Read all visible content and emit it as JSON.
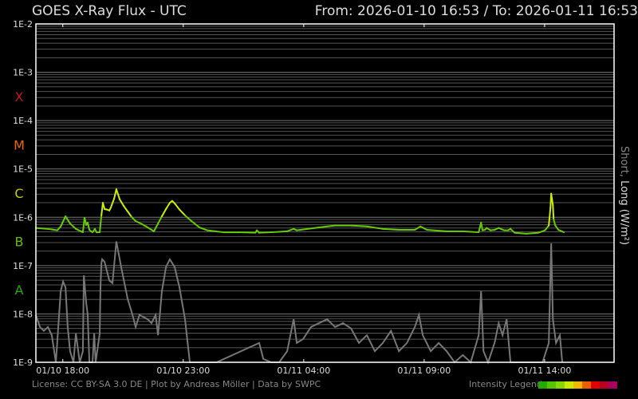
{
  "header": {
    "title": "GOES X-Ray Flux - UTC",
    "range": "From: 2026-01-10 16:53  /  To: 2026-01-11 16:53"
  },
  "footer": {
    "license": "License: CC BY-SA 3.0 DE | Plot by Andreas Möller | Data by SWPC",
    "legend_label": "Intensity Legend",
    "legend_colors": [
      "#22aa00",
      "#55c400",
      "#88d800",
      "#ccea00",
      "#f0b800",
      "#ea6000",
      "#e00000",
      "#b80020",
      "#a80060"
    ]
  },
  "chart_data": {
    "type": "line",
    "title": "GOES X-Ray Flux - UTC",
    "xlabel": "",
    "ylabel_short": "Short,",
    "ylabel_long": "Long (W/m²)",
    "y_scale": "log",
    "ylim_log10": [
      -9,
      -2
    ],
    "x_unit": "hours since 2026-01-10 16:53",
    "xlim": [
      0,
      24
    ],
    "y_ticks": [
      {
        "v": -2,
        "label": "1E-2"
      },
      {
        "v": -3,
        "label": "1E-3"
      },
      {
        "v": -4,
        "label": "1E-4"
      },
      {
        "v": -5,
        "label": "1E-5"
      },
      {
        "v": -6,
        "label": "1E-6"
      },
      {
        "v": -7,
        "label": "1E-7"
      },
      {
        "v": -8,
        "label": "1E-8"
      },
      {
        "v": -9,
        "label": "1E-9"
      }
    ],
    "classes": [
      {
        "label": "X",
        "v": -3.5,
        "color": "#cc1122"
      },
      {
        "label": "M",
        "v": -4.5,
        "color": "#ee6600"
      },
      {
        "label": "C",
        "v": -5.5,
        "color": "#cccc00"
      },
      {
        "label": "B",
        "v": -6.5,
        "color": "#66bb00"
      },
      {
        "label": "A",
        "v": -7.5,
        "color": "#22aa00"
      }
    ],
    "x_ticks": [
      {
        "v": 1.117,
        "label": "01/10 18:00"
      },
      {
        "v": 6.117,
        "label": "01/10 23:00"
      },
      {
        "v": 11.117,
        "label": "01/11 04:00"
      },
      {
        "v": 16.117,
        "label": "01/11 09:00"
      },
      {
        "v": 21.117,
        "label": "01/11 14:00"
      }
    ],
    "series": [
      {
        "name": "Long",
        "color_low": "#66cc00",
        "color_high": "#ccee00",
        "t": [
          0,
          0.5,
          0.89,
          1.03,
          1.23,
          1.42,
          1.66,
          1.95,
          2.02,
          2.09,
          2.15,
          2.22,
          2.35,
          2.45,
          2.52,
          2.65,
          2.72,
          2.78,
          2.85,
          2.95,
          3.05,
          3.11,
          3.25,
          3.34,
          3.48,
          3.64,
          3.81,
          3.97,
          4.14,
          4.4,
          4.64,
          4.9,
          5.07,
          5.23,
          5.4,
          5.56,
          5.66,
          5.79,
          5.96,
          6.19,
          6.46,
          6.79,
          7.12,
          7.78,
          8.44,
          9.11,
          9.17,
          9.27,
          9.77,
          10.43,
          10.7,
          10.83,
          11.75,
          12.42,
          13.08,
          13.74,
          14.4,
          15.07,
          15.73,
          15.96,
          16.23,
          17.05,
          17.72,
          18.38,
          18.48,
          18.54,
          18.64,
          18.71,
          18.87,
          19.04,
          19.21,
          19.3,
          19.44,
          19.6,
          19.7,
          19.87,
          20.36,
          20.86,
          21.13,
          21.29,
          21.36,
          21.39,
          21.46,
          21.49,
          21.56,
          21.69,
          21.92
        ],
        "log10_flux": [
          -6.22,
          -6.24,
          -6.27,
          -6.19,
          -5.98,
          -6.13,
          -6.24,
          -6.31,
          -6.01,
          -6.16,
          -6.11,
          -6.26,
          -6.31,
          -6.24,
          -6.31,
          -6.31,
          -5.96,
          -5.7,
          -5.83,
          -5.84,
          -5.86,
          -5.8,
          -5.61,
          -5.42,
          -5.63,
          -5.76,
          -5.88,
          -5.99,
          -6.08,
          -6.14,
          -6.21,
          -6.29,
          -6.13,
          -5.98,
          -5.83,
          -5.7,
          -5.66,
          -5.73,
          -5.84,
          -5.96,
          -6.08,
          -6.21,
          -6.27,
          -6.31,
          -6.31,
          -6.32,
          -6.27,
          -6.32,
          -6.31,
          -6.29,
          -6.24,
          -6.27,
          -6.21,
          -6.17,
          -6.17,
          -6.19,
          -6.24,
          -6.26,
          -6.26,
          -6.19,
          -6.26,
          -6.29,
          -6.29,
          -6.31,
          -6.11,
          -6.27,
          -6.26,
          -6.22,
          -6.27,
          -6.26,
          -6.22,
          -6.24,
          -6.27,
          -6.27,
          -6.24,
          -6.32,
          -6.34,
          -6.32,
          -6.27,
          -6.17,
          -5.8,
          -5.51,
          -5.75,
          -6.04,
          -6.17,
          -6.26,
          -6.31
        ]
      },
      {
        "name": "Short",
        "color": "#777777",
        "t": [
          0,
          0.17,
          0.33,
          0.5,
          0.66,
          0.83,
          1.03,
          1.13,
          1.23,
          1.32,
          1.42,
          1.56,
          1.66,
          1.82,
          1.95,
          1.99,
          2.09,
          2.15,
          2.22,
          2.35,
          2.42,
          2.48,
          2.65,
          2.68,
          2.72,
          2.75,
          2.85,
          3.05,
          3.18,
          3.34,
          3.54,
          3.81,
          4.01,
          4.14,
          4.3,
          4.64,
          4.8,
          4.97,
          5.07,
          5.23,
          5.4,
          5.56,
          5.76,
          5.96,
          6.19,
          6.39,
          7.5,
          9.27,
          9.44,
          9.77,
          10.1,
          10.43,
          10.7,
          10.83,
          11.09,
          11.42,
          11.75,
          12.09,
          12.42,
          12.75,
          13.08,
          13.41,
          13.74,
          14.07,
          14.4,
          14.74,
          15.07,
          15.4,
          15.73,
          15.9,
          16.06,
          16.39,
          16.72,
          17.05,
          17.38,
          17.72,
          18.05,
          18.38,
          18.48,
          18.58,
          18.77,
          19.04,
          19.21,
          19.37,
          19.54,
          19.7,
          20.36,
          21.03,
          21.29,
          21.39,
          21.46,
          21.59,
          21.75,
          21.85
        ],
        "log10_flux": [
          -8.02,
          -8.27,
          -8.35,
          -8.27,
          -8.44,
          -9,
          -7.53,
          -7.33,
          -7.45,
          -8.27,
          -8.77,
          -9,
          -8.4,
          -9,
          -8.77,
          -7.2,
          -7.78,
          -8.01,
          -9,
          -9,
          -8.4,
          -9,
          -8.4,
          -7.45,
          -6.95,
          -6.87,
          -6.92,
          -7.31,
          -7.36,
          -6.5,
          -7.03,
          -7.69,
          -8.02,
          -8.27,
          -8.02,
          -8.11,
          -8.19,
          -8.02,
          -8.44,
          -7.53,
          -7.03,
          -6.87,
          -7.03,
          -7.45,
          -8.11,
          -9,
          -9,
          -8.6,
          -8.93,
          -9,
          -9,
          -8.77,
          -8.11,
          -8.6,
          -8.52,
          -8.27,
          -8.19,
          -8.11,
          -8.27,
          -8.19,
          -8.3,
          -8.6,
          -8.44,
          -8.77,
          -8.6,
          -8.35,
          -8.77,
          -8.6,
          -8.27,
          -8.02,
          -8.44,
          -8.77,
          -8.6,
          -8.77,
          -9,
          -8.85,
          -9,
          -8.44,
          -7.53,
          -8.77,
          -9,
          -8.6,
          -8.19,
          -8.44,
          -8.11,
          -9,
          -9,
          -9,
          -8.6,
          -6.54,
          -8.11,
          -8.6,
          -8.44,
          -9
        ]
      }
    ]
  }
}
